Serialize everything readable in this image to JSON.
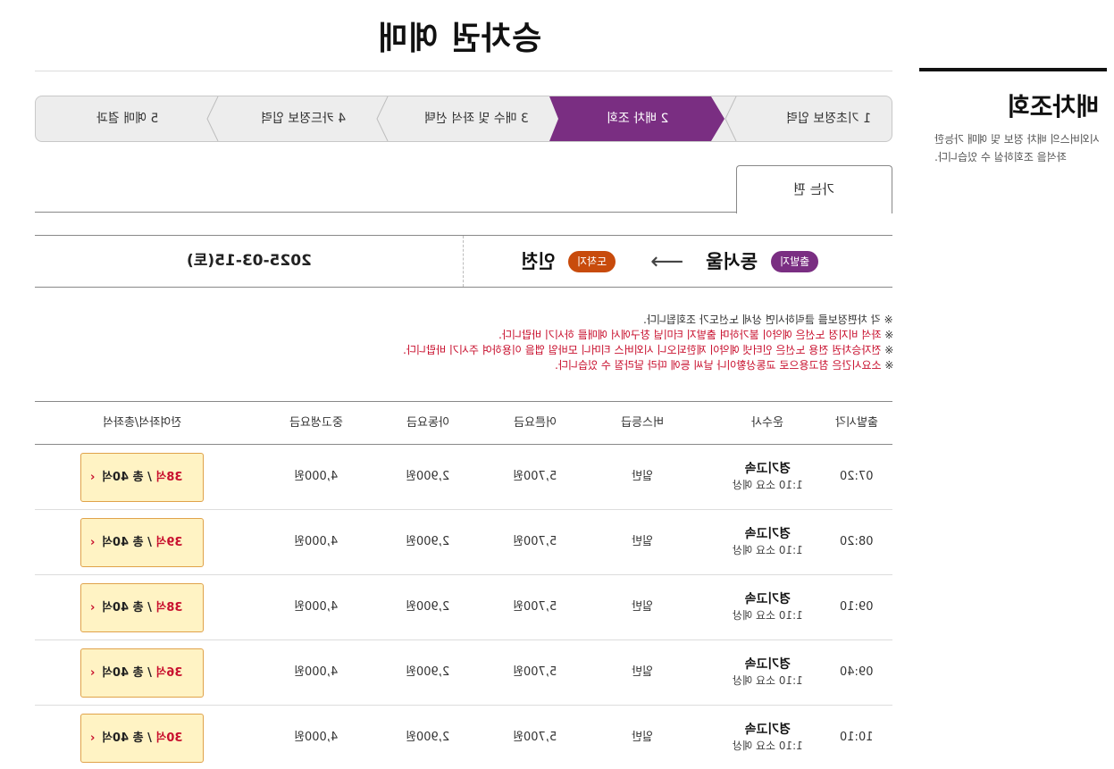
{
  "page": {
    "title": "승차권 예매"
  },
  "side": {
    "title": "배차조회",
    "description": "시외버스의 배차 정보 및 예매 가능한 좌석을 조회하실 수 있습니다."
  },
  "steps": [
    {
      "num": "1",
      "label": "기초정보 입력"
    },
    {
      "num": "2",
      "label": "배차 조회"
    },
    {
      "num": "3",
      "label": "매수 및 좌석 선택"
    },
    {
      "num": "4",
      "label": "카드정보 입력"
    },
    {
      "num": "5",
      "label": "예매 결과"
    }
  ],
  "tab": {
    "label": "가는 편"
  },
  "route": {
    "departure_badge": "출발지",
    "departure": "동서울",
    "arrival_badge": "도착지",
    "arrival": "인천",
    "date": "2025-03-15(토)"
  },
  "notices": [
    {
      "prefix": "※ ",
      "text": "각 차편정보를 클릭하시면 상세 노선도가 조회됩니다."
    },
    {
      "prefix": "※ ",
      "text": "좌석 비지정 노선은 예약이 불가하며 출발지 터미널 창구에서 예매를 하시기 바랍니다."
    },
    {
      "prefix": "※ ",
      "text": "전자승차권 전용 노선은 인터넷 예약이 제한되오니 시외버스 티머니 모바일 앱을 이용하여 주시기 바랍니다."
    },
    {
      "prefix": "※ ",
      "text": "소요시간은 참고용으로 교통상황이나 날씨 등에 따라 달라질 수 있습니다."
    }
  ],
  "table": {
    "headers": {
      "departure_time": "출발시각",
      "company": "운수사",
      "bus_class": "버스등급",
      "adult_fare": "어른요금",
      "child_fare": "아동요금",
      "student_fare": "중고생요금",
      "seats": "잔여좌석/총좌석"
    },
    "rows": [
      {
        "time": "07:20",
        "company": "경기고속",
        "duration": "1:10 소요 예상",
        "class": "일반",
        "adult": "5,700원",
        "child": "2,900원",
        "student": "4,000원",
        "seats_avail": "38석",
        "seats_total": " / 총 40석"
      },
      {
        "time": "08:20",
        "company": "경기고속",
        "duration": "1:10 소요 예상",
        "class": "일반",
        "adult": "5,700원",
        "child": "2,900원",
        "student": "4,000원",
        "seats_avail": "39석",
        "seats_total": " / 총 40석"
      },
      {
        "time": "09:10",
        "company": "경기고속",
        "duration": "1:10 소요 예상",
        "class": "일반",
        "adult": "5,700원",
        "child": "2,900원",
        "student": "4,000원",
        "seats_avail": "38석",
        "seats_total": " / 총 40석"
      },
      {
        "time": "09:40",
        "company": "경기고속",
        "duration": "1:10 소요 예상",
        "class": "일반",
        "adult": "5,700원",
        "child": "2,900원",
        "student": "4,000원",
        "seats_avail": "36석",
        "seats_total": " / 총 40석"
      },
      {
        "time": "10:10",
        "company": "경기고속",
        "duration": "1:10 소요 예상",
        "class": "일반",
        "adult": "5,700원",
        "child": "2,900원",
        "student": "4,000원",
        "seats_avail": "30석",
        "seats_total": " / 총 40석"
      }
    ]
  },
  "colors": {
    "accent_purple": "#7a2e82",
    "accent_orange": "#c84b0c",
    "notice_red": "#c8102e",
    "seat_button_bg": "#fff3c4"
  },
  "icons": {
    "route_arrow": "arrow-left-icon",
    "seat_chevron": "chevron-right-icon"
  }
}
